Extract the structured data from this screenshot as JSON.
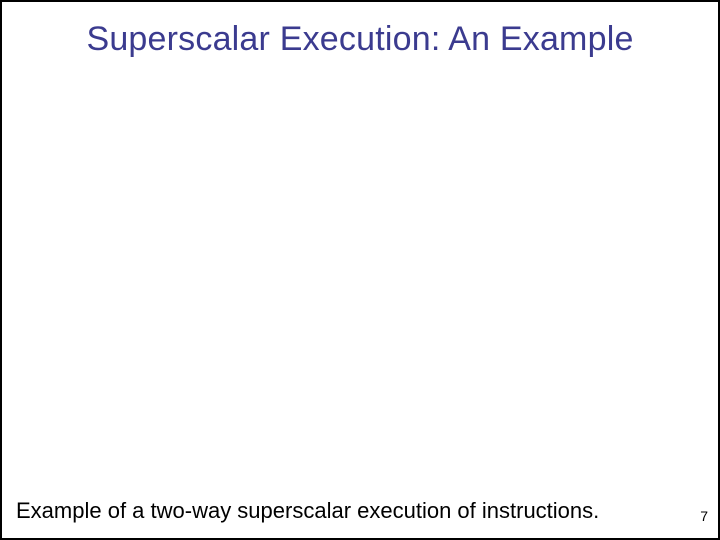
{
  "title": "Superscalar Execution: An Example",
  "caption": "Example of a two-way superscalar execution of instructions.",
  "page_number": "7"
}
